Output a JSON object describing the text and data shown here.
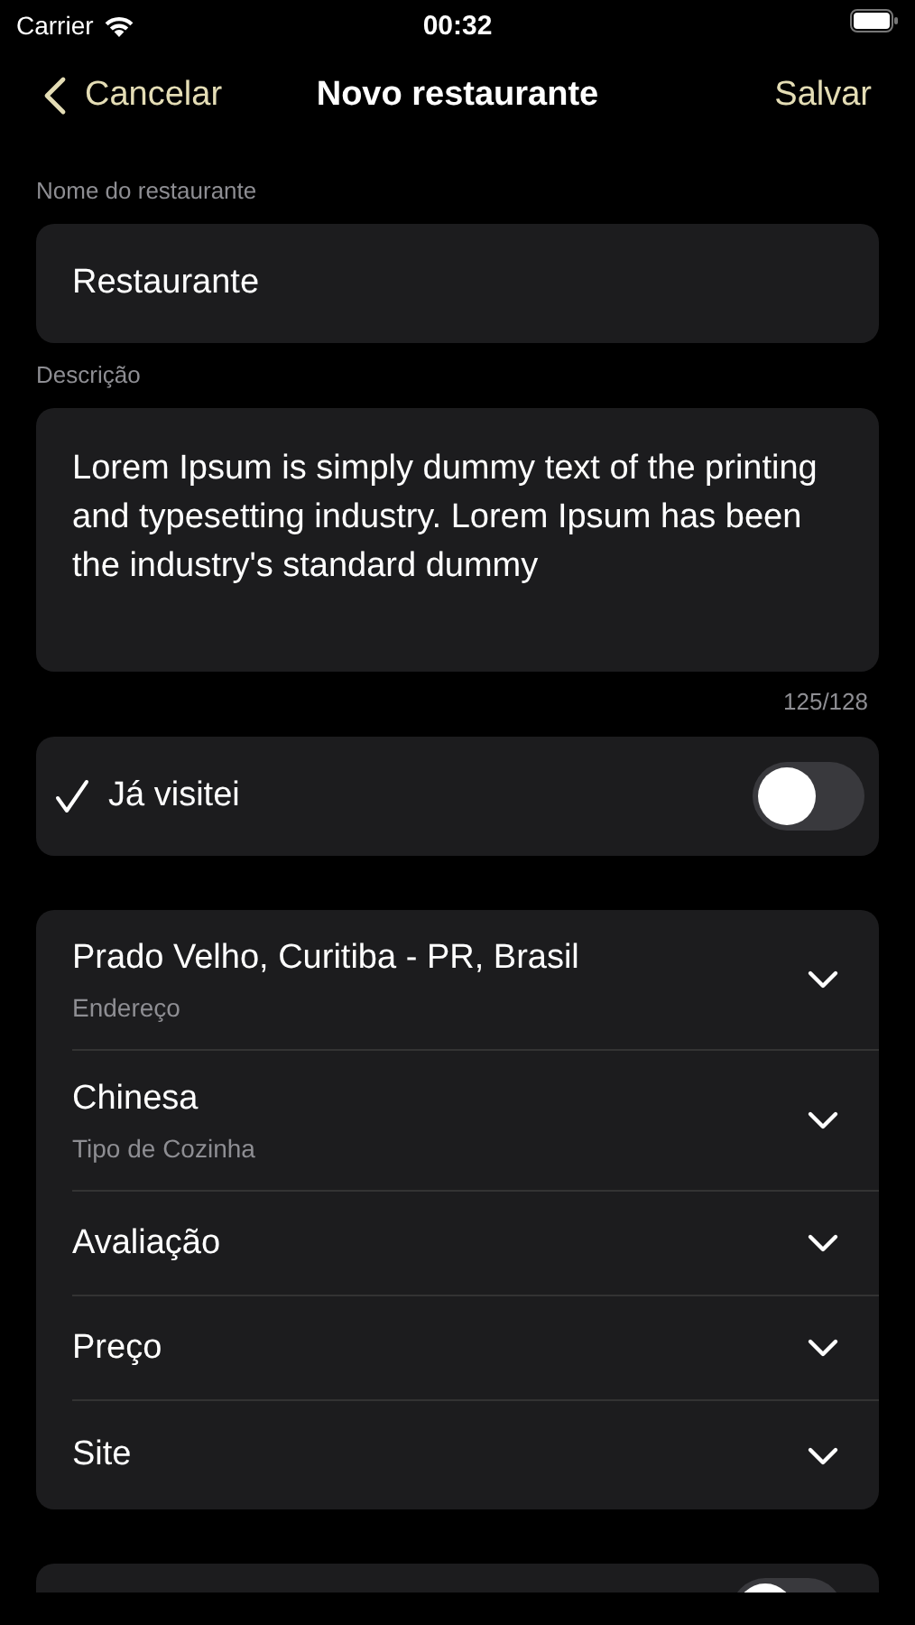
{
  "status_bar": {
    "carrier": "Carrier",
    "time": "00:32"
  },
  "nav": {
    "back": "Cancelar",
    "title": "Novo restaurante",
    "action": "Salvar"
  },
  "name_field": {
    "label": "Nome do restaurante",
    "value": "Restaurante"
  },
  "description_field": {
    "label": "Descrição",
    "value": "Lorem Ipsum is simply dummy text of the printing and typesetting industry. Lorem Ipsum has been the industry's standard dummy",
    "counter": "125/128"
  },
  "visited": {
    "label": "Já visitei",
    "on": false
  },
  "details": [
    {
      "title": "Prado Velho, Curitiba - PR, Brasil",
      "subtitle": "Endereço"
    },
    {
      "title": "Chinesa",
      "subtitle": "Tipo de Cozinha"
    },
    {
      "title": "Avaliação"
    },
    {
      "title": "Preço"
    },
    {
      "title": "Site"
    }
  ],
  "next_toggle": {
    "on": false
  }
}
